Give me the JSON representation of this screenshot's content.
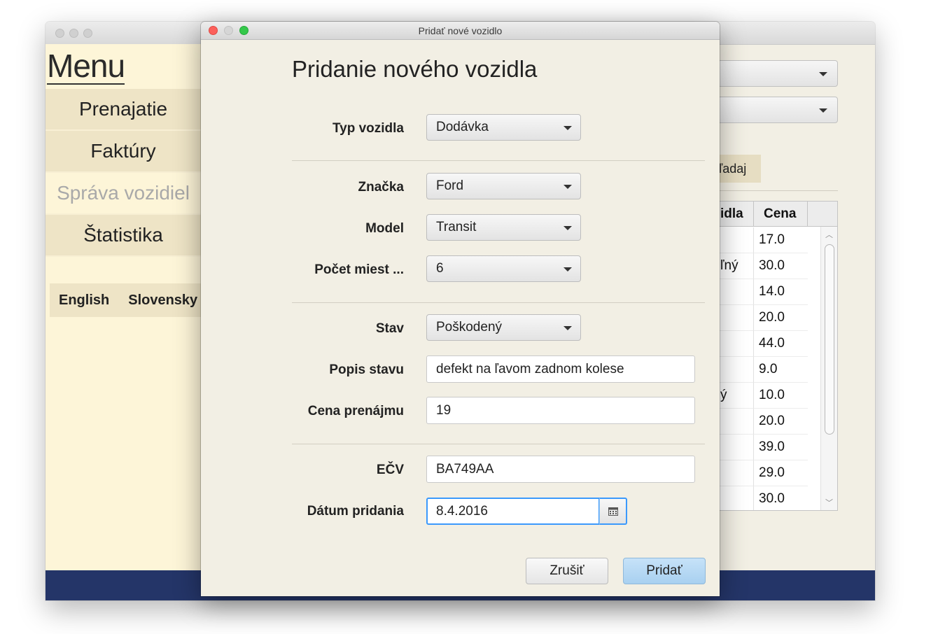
{
  "main_window": {
    "sidebar": {
      "title": "Menu",
      "items": [
        {
          "label": "Prenajatie"
        },
        {
          "label": "Faktúry"
        },
        {
          "label": "Správa vozidiel"
        },
        {
          "label": "Štatistika"
        }
      ],
      "languages": [
        "English",
        "Slovensky"
      ]
    },
    "search_button_label": "ľadaj",
    "table": {
      "headers": [
        "idla",
        "Cena"
      ],
      "rows": [
        {
          "c1": "",
          "cena": "17.0"
        },
        {
          "c1": "ľný",
          "cena": "30.0"
        },
        {
          "c1": "",
          "cena": "14.0"
        },
        {
          "c1": "",
          "cena": "20.0"
        },
        {
          "c1": "",
          "cena": "44.0"
        },
        {
          "c1": "",
          "cena": "9.0"
        },
        {
          "c1": "ý",
          "cena": "10.0"
        },
        {
          "c1": "",
          "cena": "20.0"
        },
        {
          "c1": "",
          "cena": "39.0"
        },
        {
          "c1": "",
          "cena": "29.0"
        },
        {
          "c1": "",
          "cena": "30.0"
        }
      ]
    },
    "bottom_bar_color": "#243568"
  },
  "dialog": {
    "window_title": "Pridať nové vozidlo",
    "heading": "Pridanie nového vozidla",
    "fields": {
      "vehicle_type": {
        "label": "Typ vozidla",
        "value": "Dodávka"
      },
      "brand": {
        "label": "Značka",
        "value": "Ford"
      },
      "model": {
        "label": "Model",
        "value": "Transit"
      },
      "seats": {
        "label": "Počet miest ...",
        "value": "6"
      },
      "condition": {
        "label": "Stav",
        "value": "Poškodený"
      },
      "condition_desc": {
        "label": "Popis stavu",
        "value": "defekt na ľavom zadnom kolese"
      },
      "rental_price": {
        "label": "Cena prenájmu",
        "value": "19"
      },
      "plate": {
        "label": "EČV",
        "value": "BA749AA"
      },
      "date_added": {
        "label": "Dátum pridania",
        "value": "8.4.2016"
      }
    },
    "buttons": {
      "cancel": "Zrušiť",
      "add": "Pridať"
    },
    "icons": {
      "date_picker": "calendar-icon"
    },
    "accent_color": "#3b99fc"
  }
}
